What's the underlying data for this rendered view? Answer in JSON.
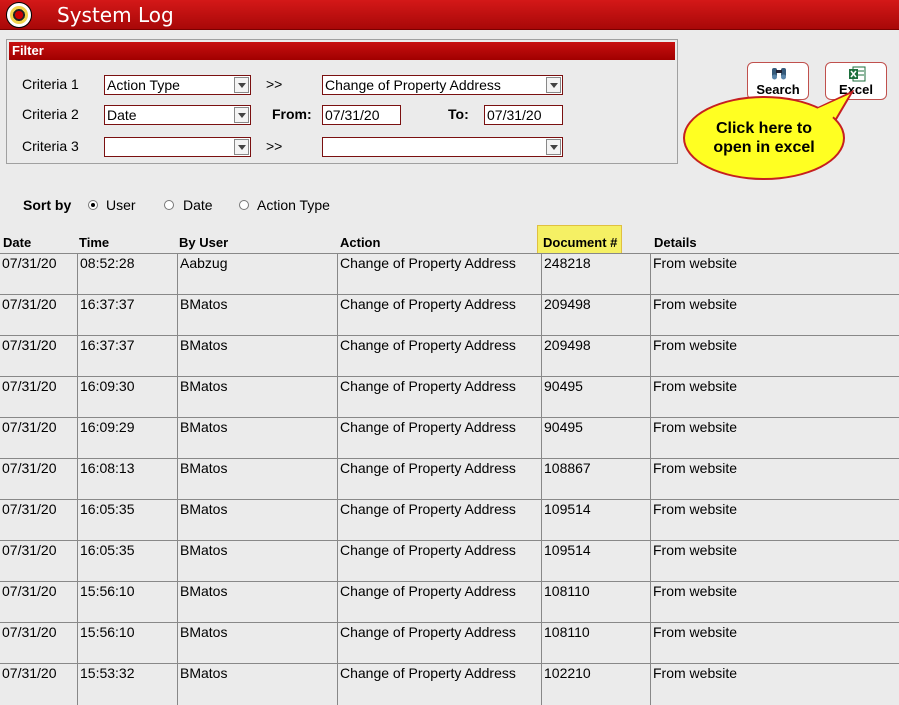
{
  "app": {
    "title": "System Log"
  },
  "filter": {
    "header": "Filter",
    "criteria1": {
      "label": "Criteria 1",
      "value": "Action Type",
      "separator": ">>",
      "value2": "Change of Property Address"
    },
    "criteria2": {
      "label": "Criteria 2",
      "value": "Date",
      "from_label": "From:",
      "from_value": "07/31/20",
      "to_label": "To:",
      "to_value": "07/31/20"
    },
    "criteria3": {
      "label": "Criteria 3",
      "value": "",
      "separator": ">>",
      "value2": ""
    }
  },
  "buttons": {
    "search": "Search",
    "excel": "Excel"
  },
  "callout": {
    "line1": "Click here to",
    "line2": "open in excel"
  },
  "sort": {
    "label": "Sort by",
    "options": [
      "User",
      "Date",
      "Action Type"
    ],
    "selected": "User"
  },
  "table": {
    "headers": [
      "Date",
      "Time",
      "By User",
      "Action",
      "Document #",
      "Details"
    ],
    "rows": [
      [
        "07/31/20",
        "08:52:28",
        "Aabzug",
        "Change of Property Address",
        "248218",
        "From website"
      ],
      [
        "07/31/20",
        "16:37:37",
        "BMatos",
        "Change of Property Address",
        "209498",
        "From website"
      ],
      [
        "07/31/20",
        "16:37:37",
        "BMatos",
        "Change of Property Address",
        "209498",
        "From website"
      ],
      [
        "07/31/20",
        "16:09:30",
        "BMatos",
        "Change of Property Address",
        "90495",
        "From website"
      ],
      [
        "07/31/20",
        "16:09:29",
        "BMatos",
        "Change of Property Address",
        "90495",
        "From website"
      ],
      [
        "07/31/20",
        "16:08:13",
        "BMatos",
        "Change of Property Address",
        "108867",
        "From website"
      ],
      [
        "07/31/20",
        "16:05:35",
        "BMatos",
        "Change of Property Address",
        "109514",
        "From website"
      ],
      [
        "07/31/20",
        "16:05:35",
        "BMatos",
        "Change of Property Address",
        "109514",
        "From website"
      ],
      [
        "07/31/20",
        "15:56:10",
        "BMatos",
        "Change of Property Address",
        "108110",
        "From website"
      ],
      [
        "07/31/20",
        "15:56:10",
        "BMatos",
        "Change of Property Address",
        "108110",
        "From website"
      ],
      [
        "07/31/20",
        "15:53:32",
        "BMatos",
        "Change of Property Address",
        "102210",
        "From website"
      ]
    ]
  },
  "colors": {
    "title_bar": "#c41010",
    "callout_fill": "#ffff22",
    "header_highlight": "#f5f064"
  },
  "icons": {
    "search": "binoculars-icon",
    "excel": "excel-icon"
  }
}
